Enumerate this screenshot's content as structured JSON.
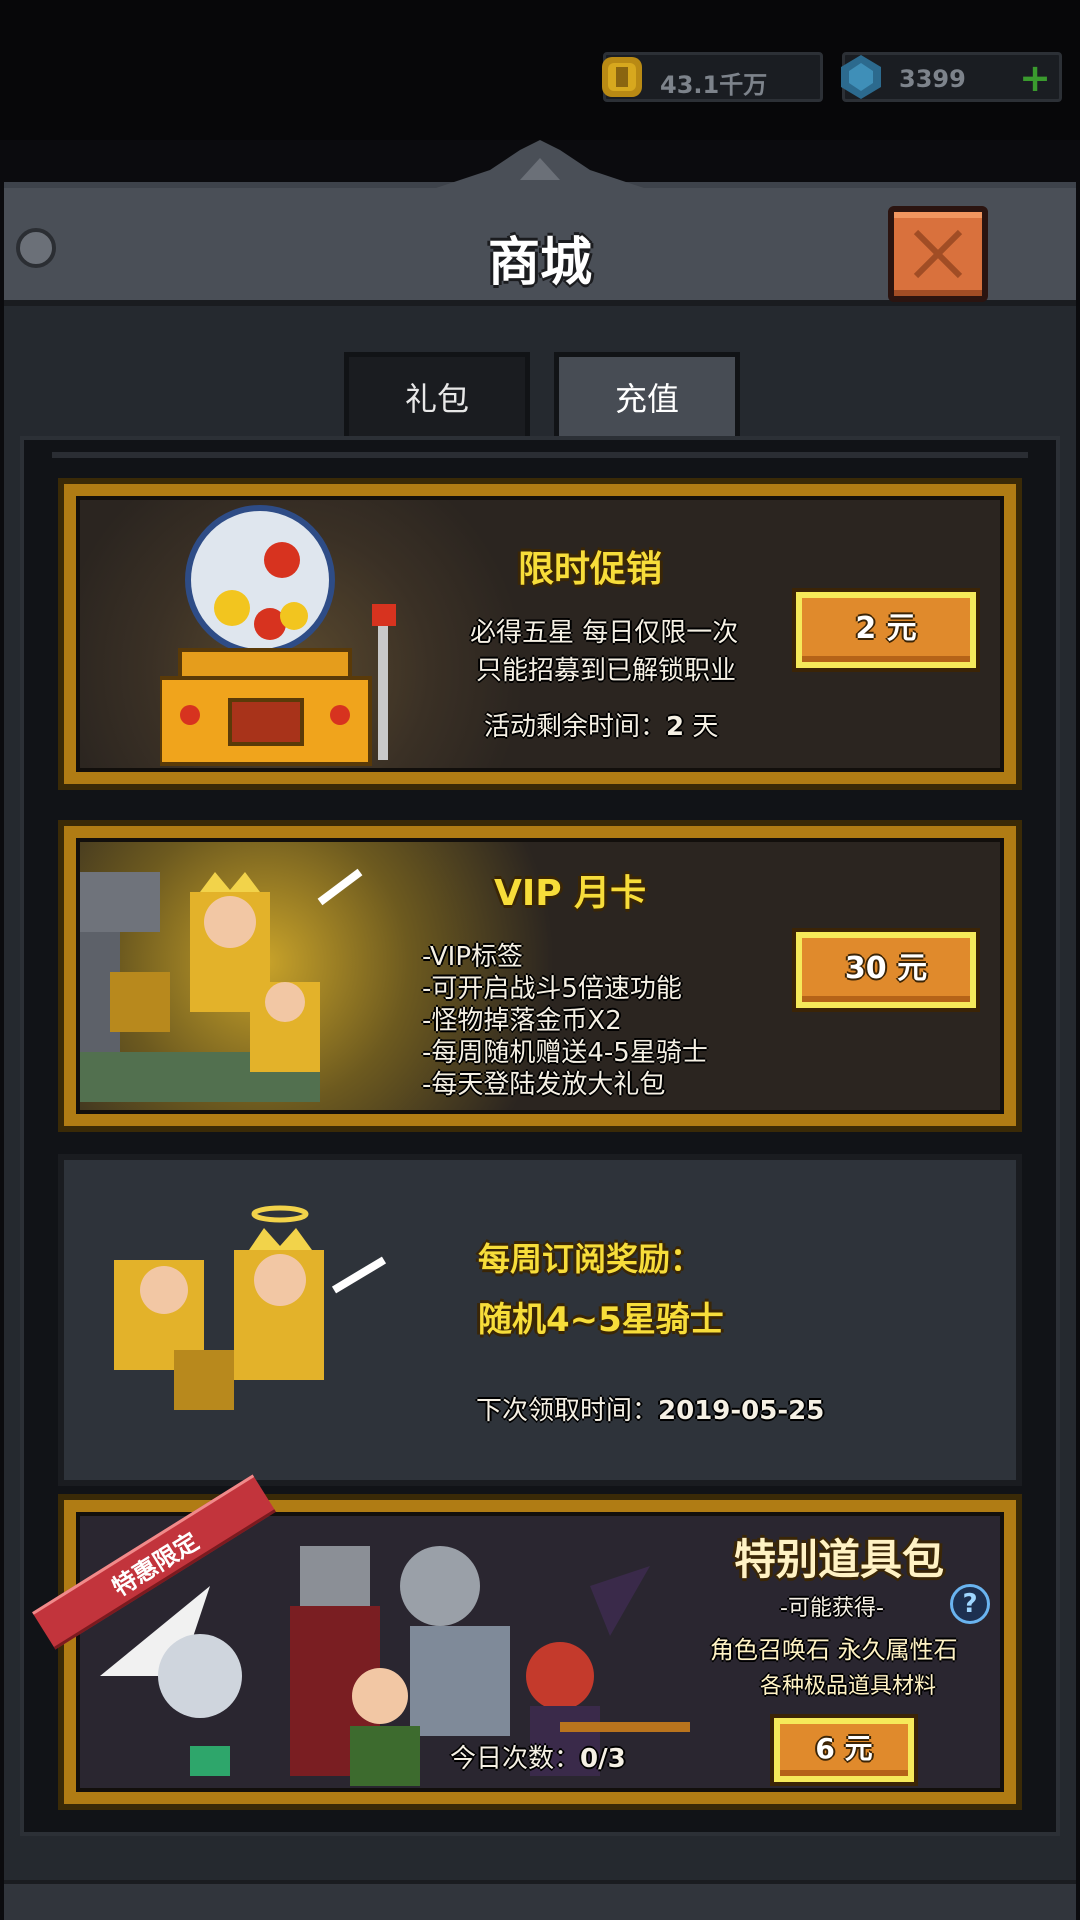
{
  "currency": {
    "gold_value": "43.1千万",
    "gem_value": "3399",
    "add_label": "+"
  },
  "header": {
    "title": "商城"
  },
  "tabs": [
    {
      "label": "礼包",
      "active": false
    },
    {
      "label": "充值",
      "active": true
    }
  ],
  "offers": {
    "flash_sale": {
      "title": "限时促销",
      "line1": "必得五星 每日仅限一次",
      "line2": "只能招募到已解锁职业",
      "remaining_label": "活动剩余时间：",
      "remaining_value": "2",
      "remaining_unit": "天",
      "price": "2 元"
    },
    "vip_card": {
      "title": "VIP 月卡",
      "benefits": [
        "-VIP标签",
        "-可开启战斗5倍速功能",
        "-怪物掉落金币X2",
        "-每周随机赠送4-5星骑士",
        "-每天登陆发放大礼包"
      ],
      "price": "30 元"
    },
    "weekly_sub": {
      "line1": "每周订阅奖励：",
      "line2": "随机4~5星骑士",
      "next_label": "下次领取时间：",
      "next_date": "2019-05-25"
    },
    "special_pack": {
      "ribbon": "特惠限定",
      "title": "特别道具包",
      "subtitle": "-可能获得-",
      "help": "?",
      "line1": "角色召唤石 永久属性石",
      "line2": "各种极品道具材料",
      "count_label": "今日次数：",
      "count_value": "0/3",
      "price": "6 元"
    }
  },
  "colors": {
    "accent_gold": "#f7dd3a",
    "button_orange": "#e08a2c",
    "close_orange": "#d9713d",
    "panel_bg": "#25292f"
  }
}
